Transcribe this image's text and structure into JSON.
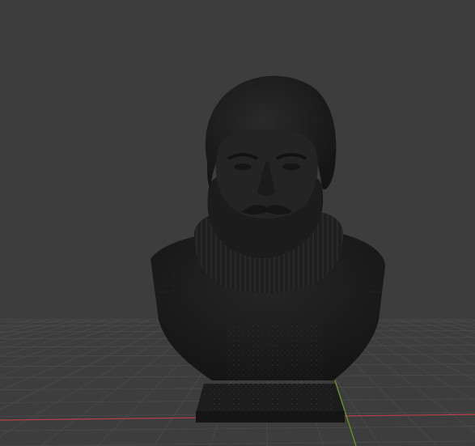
{
  "viewport": {
    "background_color": "#3d3d3d",
    "grid_line_color": "#4a4a4a",
    "x_axis_color": "#b8404a",
    "y_axis_color": "#6c9a2a"
  },
  "model": {
    "name": "bust-sculpture",
    "shading": "solid",
    "surface_color": "#1e1e1e",
    "base_color": "#1a1a1a"
  }
}
